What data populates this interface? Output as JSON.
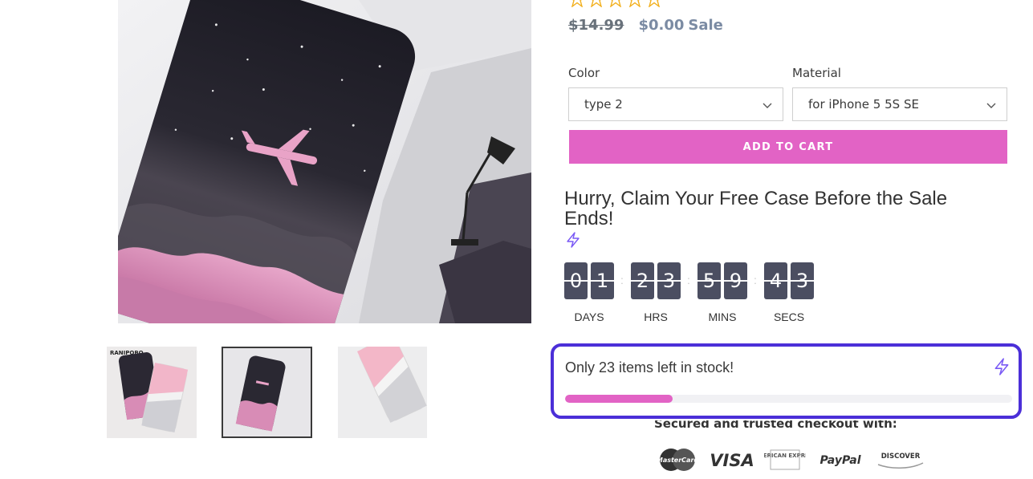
{
  "product": {
    "rating_stars": 5,
    "price": {
      "compare_at": "$14.99",
      "current": "$0.00",
      "sale_label": "Sale"
    },
    "options": [
      {
        "label": "Color",
        "selected": "type 2"
      },
      {
        "label": "Material",
        "selected": "for iPhone 5 5S SE"
      }
    ],
    "add_to_cart_label": "ADD TO CART",
    "thumbnail_brand_text": "RANIPOBO"
  },
  "countdown": {
    "heading": "Hurry, Claim Your Free Case Before the Sale Ends!",
    "units": [
      {
        "label": "DAYS",
        "digits": [
          "0",
          "1"
        ]
      },
      {
        "label": "HRS",
        "digits": [
          "2",
          "3"
        ]
      },
      {
        "label": "MINS",
        "digits": [
          "5",
          "9"
        ]
      },
      {
        "label": "SECS",
        "digits": [
          "4",
          "3"
        ]
      }
    ],
    "separator": ":",
    "digit_color": "#4b4e61"
  },
  "stock": {
    "message": "Only 23 items left in stock!",
    "progress_fraction": 0.24,
    "bar_color": "#e263c5",
    "border_color": "#4b2fd8"
  },
  "trust": {
    "heading": "Secured and trusted checkout with:",
    "payment_methods": [
      {
        "name": "MasterCard",
        "icon": "mastercard-icon"
      },
      {
        "name": "VISA",
        "icon": "visa-icon"
      },
      {
        "name": "AMERICAN EXPRESS",
        "icon": "amex-icon"
      },
      {
        "name": "PayPal",
        "icon": "paypal-icon"
      },
      {
        "name": "DISCOVER",
        "icon": "discover-icon"
      }
    ]
  },
  "colors": {
    "accent": "#e263c5",
    "highlight": "#4b2fd8",
    "bolt": "#7a5af5"
  }
}
